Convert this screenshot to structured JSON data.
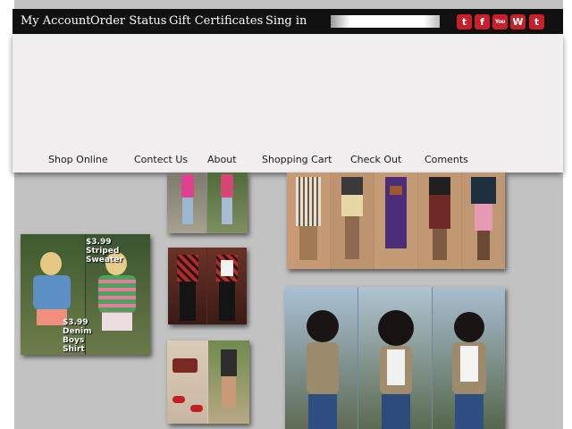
{
  "topbar": {
    "links": [
      "My Account",
      "Order Status",
      "Gift Certificates",
      "Sing in"
    ],
    "search": {
      "value": "",
      "placeholder": ""
    },
    "social": [
      {
        "icon": "twitter-icon",
        "glyph": "t"
      },
      {
        "icon": "facebook-icon",
        "glyph": "f"
      },
      {
        "icon": "youtube-icon",
        "glyph": "You Tube"
      },
      {
        "icon": "wordpress-icon",
        "glyph": "W"
      },
      {
        "icon": "tumblr-icon",
        "glyph": "t"
      }
    ]
  },
  "nav": {
    "items": [
      "Shop Online",
      "Contect Us",
      "About",
      "Shopping Cart",
      "Check Out",
      "Coments"
    ]
  },
  "promo": {
    "sweater_price": "$3.99",
    "sweater_label_1": "Striped",
    "sweater_label_2": "Sweater",
    "shirt_price": "$3.99",
    "shirt_label_1": "Denim",
    "shirt_label_2": "Boys",
    "shirt_label_3": "Shirt"
  },
  "colors": {
    "topbar": "#111111",
    "social": "#c8202b",
    "panel": "#f0eeef",
    "backdrop": "#c2c2c2"
  }
}
